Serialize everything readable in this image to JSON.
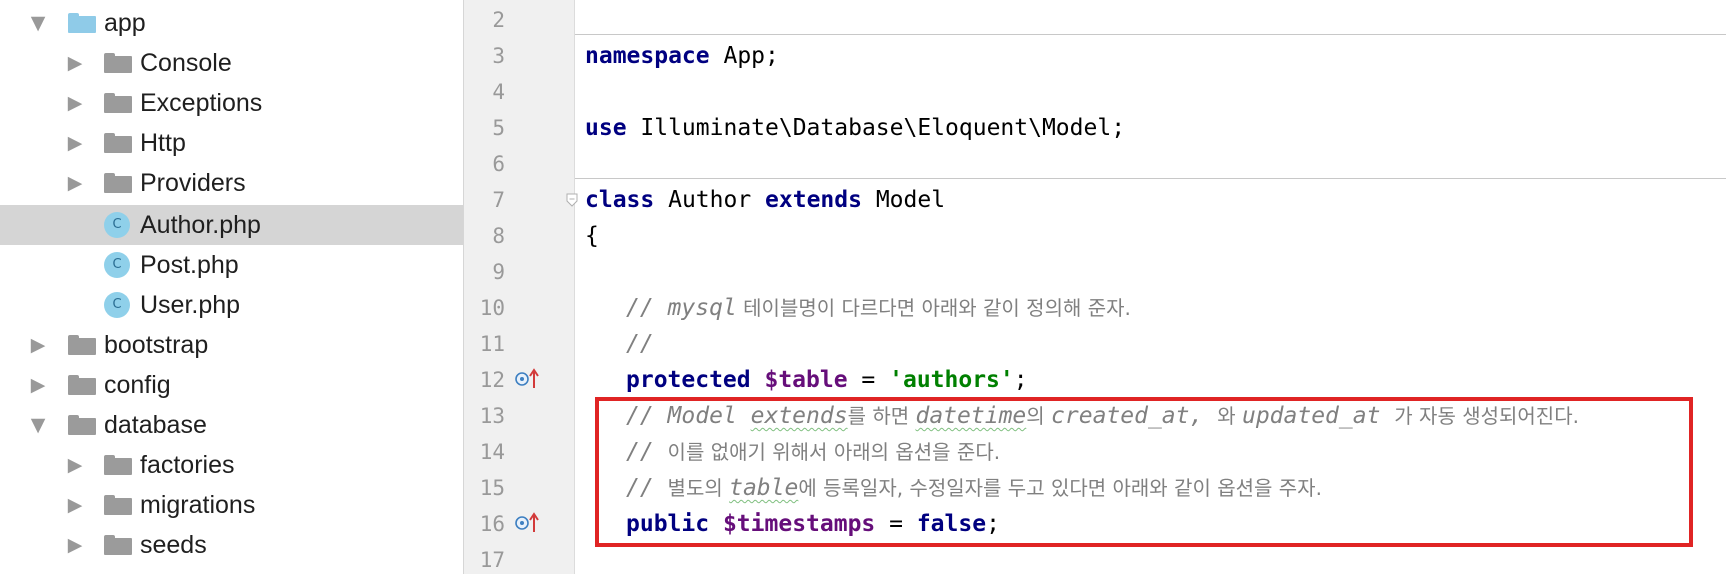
{
  "project_tree": {
    "items": [
      {
        "label": "app",
        "icon": "folder-icon",
        "expanded": true
      },
      {
        "label": "Console",
        "icon": "folder-icon",
        "expanded": false
      },
      {
        "label": "Exceptions",
        "icon": "folder-icon",
        "expanded": false
      },
      {
        "label": "Http",
        "icon": "folder-icon",
        "expanded": false
      },
      {
        "label": "Providers",
        "icon": "folder-icon",
        "expanded": false
      },
      {
        "label": "Author.php",
        "icon": "php-class-icon",
        "selected": true,
        "icon_letter": "C"
      },
      {
        "label": "Post.php",
        "icon": "php-class-icon",
        "icon_letter": "C"
      },
      {
        "label": "User.php",
        "icon": "php-class-icon",
        "icon_letter": "C"
      },
      {
        "label": "bootstrap",
        "icon": "folder-icon",
        "expanded": false
      },
      {
        "label": "config",
        "icon": "folder-icon",
        "expanded": false
      },
      {
        "label": "database",
        "icon": "folder-icon",
        "expanded": true
      },
      {
        "label": "factories",
        "icon": "folder-icon",
        "expanded": false
      },
      {
        "label": "migrations",
        "icon": "folder-icon",
        "expanded": false
      },
      {
        "label": "seeds",
        "icon": "folder-icon",
        "expanded": false
      }
    ]
  },
  "editor": {
    "line_numbers": [
      "2",
      "3",
      "4",
      "5",
      "6",
      "7",
      "8",
      "9",
      "10",
      "11",
      "12",
      "13",
      "14",
      "15",
      "16",
      "17"
    ],
    "code": {
      "l3_kw": "namespace",
      "l3_rest": " App;",
      "l5_kw": "use",
      "l5_rest": " Illuminate\\Database\\Eloquent\\Model;",
      "l7_kw1": "class",
      "l7_name": " Author ",
      "l7_kw2": "extends",
      "l7_rest": " Model",
      "l8": "{",
      "l10_a": "// mysql",
      "l10_b": " 테이블명이 다르다면 아래와 같이 정의해 준자.",
      "l11": "//",
      "l12_kw": "protected",
      "l12_var": "$table",
      "l12_eq": " = ",
      "l12_str": "'authors'",
      "l12_end": ";",
      "l13_a": "// Model ",
      "l13_b": "extends",
      "l13_c": "를 하면 ",
      "l13_d": "datetime",
      "l13_e": "의 ",
      "l13_f": "created_at, ",
      "l13_g": "와 ",
      "l13_h": "updated_at ",
      "l13_i": "가 자동 생성되어진다.",
      "l14_a": "// ",
      "l14_b": "이를 없애기 위해서 아래의 옵션을 준다.",
      "l15_a": "// ",
      "l15_b": "별도의 ",
      "l15_c": "table",
      "l15_d": "에 등록일자, 수정일자를 두고 있다면 아래와 같이 옵션을 주자.",
      "l16_kw": "public",
      "l16_var": "$timestamps",
      "l16_eq": " = ",
      "l16_kw2": "false",
      "l16_end": ";"
    },
    "icons": {
      "override_line12": "override-icon",
      "override_line16": "override-icon",
      "fold_line7": "fold-icon"
    },
    "colors": {
      "keyword": "#000080",
      "variable": "#660e7a",
      "string": "#008000",
      "comment": "#808080",
      "highlight_box": "#e02424",
      "selected_row": "#d5d5d5"
    }
  }
}
